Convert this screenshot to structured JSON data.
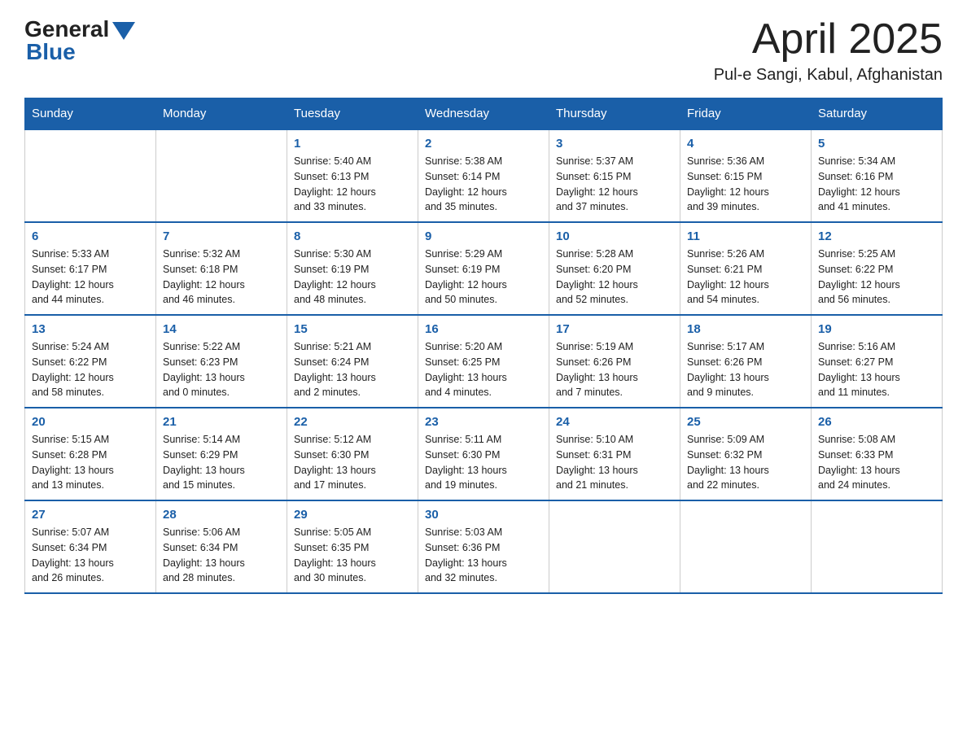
{
  "logo": {
    "general": "General",
    "blue": "Blue"
  },
  "title": "April 2025",
  "location": "Pul-e Sangi, Kabul, Afghanistan",
  "weekdays": [
    "Sunday",
    "Monday",
    "Tuesday",
    "Wednesday",
    "Thursday",
    "Friday",
    "Saturday"
  ],
  "weeks": [
    [
      {
        "day": "",
        "info": ""
      },
      {
        "day": "",
        "info": ""
      },
      {
        "day": "1",
        "info": "Sunrise: 5:40 AM\nSunset: 6:13 PM\nDaylight: 12 hours\nand 33 minutes."
      },
      {
        "day": "2",
        "info": "Sunrise: 5:38 AM\nSunset: 6:14 PM\nDaylight: 12 hours\nand 35 minutes."
      },
      {
        "day": "3",
        "info": "Sunrise: 5:37 AM\nSunset: 6:15 PM\nDaylight: 12 hours\nand 37 minutes."
      },
      {
        "day": "4",
        "info": "Sunrise: 5:36 AM\nSunset: 6:15 PM\nDaylight: 12 hours\nand 39 minutes."
      },
      {
        "day": "5",
        "info": "Sunrise: 5:34 AM\nSunset: 6:16 PM\nDaylight: 12 hours\nand 41 minutes."
      }
    ],
    [
      {
        "day": "6",
        "info": "Sunrise: 5:33 AM\nSunset: 6:17 PM\nDaylight: 12 hours\nand 44 minutes."
      },
      {
        "day": "7",
        "info": "Sunrise: 5:32 AM\nSunset: 6:18 PM\nDaylight: 12 hours\nand 46 minutes."
      },
      {
        "day": "8",
        "info": "Sunrise: 5:30 AM\nSunset: 6:19 PM\nDaylight: 12 hours\nand 48 minutes."
      },
      {
        "day": "9",
        "info": "Sunrise: 5:29 AM\nSunset: 6:19 PM\nDaylight: 12 hours\nand 50 minutes."
      },
      {
        "day": "10",
        "info": "Sunrise: 5:28 AM\nSunset: 6:20 PM\nDaylight: 12 hours\nand 52 minutes."
      },
      {
        "day": "11",
        "info": "Sunrise: 5:26 AM\nSunset: 6:21 PM\nDaylight: 12 hours\nand 54 minutes."
      },
      {
        "day": "12",
        "info": "Sunrise: 5:25 AM\nSunset: 6:22 PM\nDaylight: 12 hours\nand 56 minutes."
      }
    ],
    [
      {
        "day": "13",
        "info": "Sunrise: 5:24 AM\nSunset: 6:22 PM\nDaylight: 12 hours\nand 58 minutes."
      },
      {
        "day": "14",
        "info": "Sunrise: 5:22 AM\nSunset: 6:23 PM\nDaylight: 13 hours\nand 0 minutes."
      },
      {
        "day": "15",
        "info": "Sunrise: 5:21 AM\nSunset: 6:24 PM\nDaylight: 13 hours\nand 2 minutes."
      },
      {
        "day": "16",
        "info": "Sunrise: 5:20 AM\nSunset: 6:25 PM\nDaylight: 13 hours\nand 4 minutes."
      },
      {
        "day": "17",
        "info": "Sunrise: 5:19 AM\nSunset: 6:26 PM\nDaylight: 13 hours\nand 7 minutes."
      },
      {
        "day": "18",
        "info": "Sunrise: 5:17 AM\nSunset: 6:26 PM\nDaylight: 13 hours\nand 9 minutes."
      },
      {
        "day": "19",
        "info": "Sunrise: 5:16 AM\nSunset: 6:27 PM\nDaylight: 13 hours\nand 11 minutes."
      }
    ],
    [
      {
        "day": "20",
        "info": "Sunrise: 5:15 AM\nSunset: 6:28 PM\nDaylight: 13 hours\nand 13 minutes."
      },
      {
        "day": "21",
        "info": "Sunrise: 5:14 AM\nSunset: 6:29 PM\nDaylight: 13 hours\nand 15 minutes."
      },
      {
        "day": "22",
        "info": "Sunrise: 5:12 AM\nSunset: 6:30 PM\nDaylight: 13 hours\nand 17 minutes."
      },
      {
        "day": "23",
        "info": "Sunrise: 5:11 AM\nSunset: 6:30 PM\nDaylight: 13 hours\nand 19 minutes."
      },
      {
        "day": "24",
        "info": "Sunrise: 5:10 AM\nSunset: 6:31 PM\nDaylight: 13 hours\nand 21 minutes."
      },
      {
        "day": "25",
        "info": "Sunrise: 5:09 AM\nSunset: 6:32 PM\nDaylight: 13 hours\nand 22 minutes."
      },
      {
        "day": "26",
        "info": "Sunrise: 5:08 AM\nSunset: 6:33 PM\nDaylight: 13 hours\nand 24 minutes."
      }
    ],
    [
      {
        "day": "27",
        "info": "Sunrise: 5:07 AM\nSunset: 6:34 PM\nDaylight: 13 hours\nand 26 minutes."
      },
      {
        "day": "28",
        "info": "Sunrise: 5:06 AM\nSunset: 6:34 PM\nDaylight: 13 hours\nand 28 minutes."
      },
      {
        "day": "29",
        "info": "Sunrise: 5:05 AM\nSunset: 6:35 PM\nDaylight: 13 hours\nand 30 minutes."
      },
      {
        "day": "30",
        "info": "Sunrise: 5:03 AM\nSunset: 6:36 PM\nDaylight: 13 hours\nand 32 minutes."
      },
      {
        "day": "",
        "info": ""
      },
      {
        "day": "",
        "info": ""
      },
      {
        "day": "",
        "info": ""
      }
    ]
  ]
}
